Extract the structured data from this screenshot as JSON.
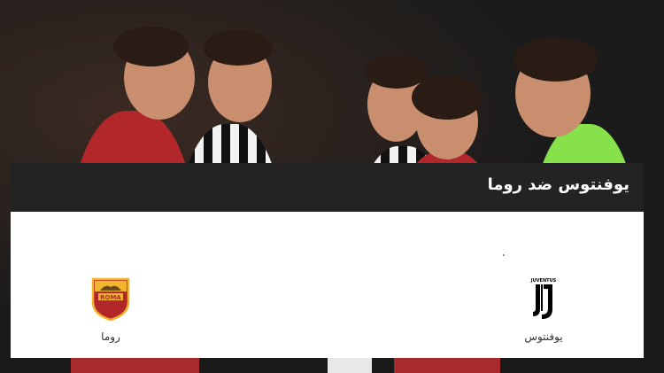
{
  "article": {
    "title": "يوفنتوس ضد روما"
  },
  "match": {
    "home_team": {
      "name": "يوفنتوس",
      "logo_text": "JUVENTUS"
    },
    "away_team": {
      "name": "روما",
      "logo_text": "ROMA"
    }
  },
  "colors": {
    "title_bar": "#232323",
    "card": "#ffffff",
    "roma_red": "#b1272a",
    "roma_gold": "#f1b52d"
  }
}
